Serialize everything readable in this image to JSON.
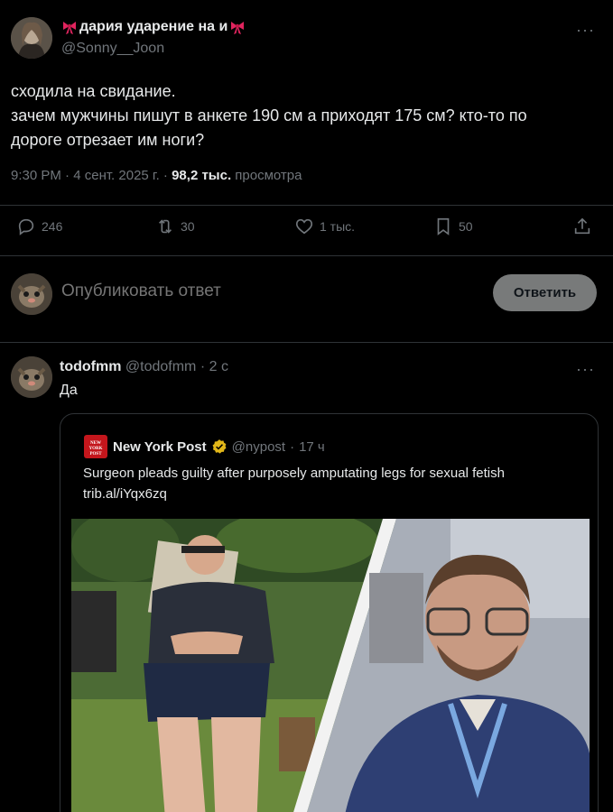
{
  "main_tweet": {
    "author_name": "дария ударение на и",
    "author_handle": "@Sonny__Joon",
    "more_label": "···",
    "text_lines": [
      "сходила на свидание.",
      "зачем мужчины пишут в анкете 190 см а приходят 175 см? кто-то по",
      "дороге отрезает им ноги?"
    ],
    "time": "9:30 PM",
    "date": "4 сент. 2025 г.",
    "views_count": "98,2 тыс.",
    "views_label": "просмотра",
    "actions": {
      "replies": "246",
      "reposts": "30",
      "likes": "1 тыс.",
      "bookmarks": "50"
    }
  },
  "composer": {
    "placeholder": "Опубликовать ответ",
    "button_label": "Ответить"
  },
  "reply": {
    "author_name": "todofmm",
    "author_handle": "@todofmm",
    "time": "2 с",
    "more_label": "···",
    "text": "Да",
    "quote": {
      "logo_text": "NEW YORK POST",
      "author_name": "New York Post",
      "author_handle": "@nypost",
      "time": "17 ч",
      "text_line1": "Surgeon pleads guilty after purposely amputating legs for sexual fetish",
      "text_line2": "trib.al/iYqx6zq"
    }
  },
  "colors": {
    "background": "#000000",
    "text": "#e7e9ea",
    "muted": "#71767b",
    "divider": "#2f3336",
    "verified_gold": "#e2b719",
    "brand_red": "#c4161c"
  }
}
